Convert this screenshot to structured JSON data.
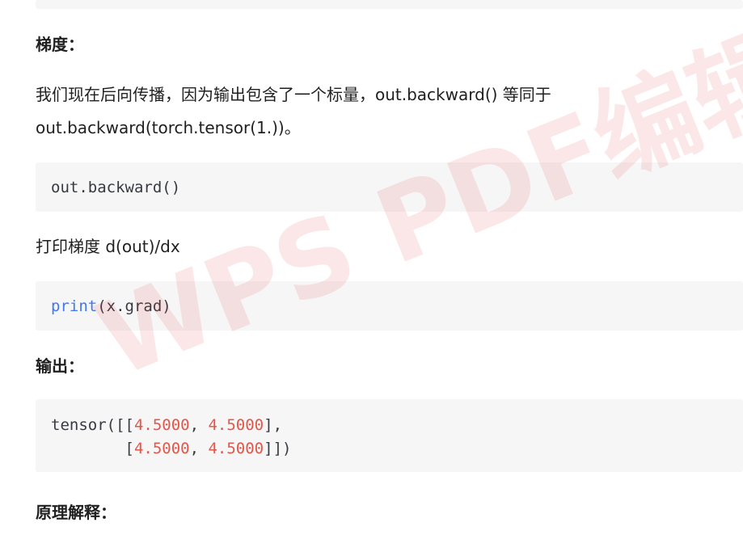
{
  "blocks": {
    "gradient_heading": "梯度：",
    "para_line1": "我们现在后向传播，因为输出包含了一个标量，out.backward() 等同于",
    "para_line2": "out.backward(torch.tensor(1.))。",
    "code1": "out.backward()",
    "print_heading": "打印梯度 d(out)/dx",
    "code2_fn": "print",
    "code2_args": "(x.grad)",
    "output_heading": "输出：",
    "output_line1_prefix": "tensor([[",
    "output_value_a": "4.5000",
    "output_value_b": "4.5000",
    "output_line1_suffix": "],",
    "output_line2_prefix": "        [",
    "output_value_c": "4.5000",
    "output_value_d": "4.5000",
    "output_line2_suffix": "]])",
    "output_sep": ", ",
    "principle_heading": "原理解释："
  },
  "watermark": {
    "text": "WPS PDF编辑试",
    "color": "#e1373c"
  },
  "colors": {
    "keyword": "#4078f2",
    "number": "#e45649",
    "code_bg": "#f6f6f6"
  }
}
